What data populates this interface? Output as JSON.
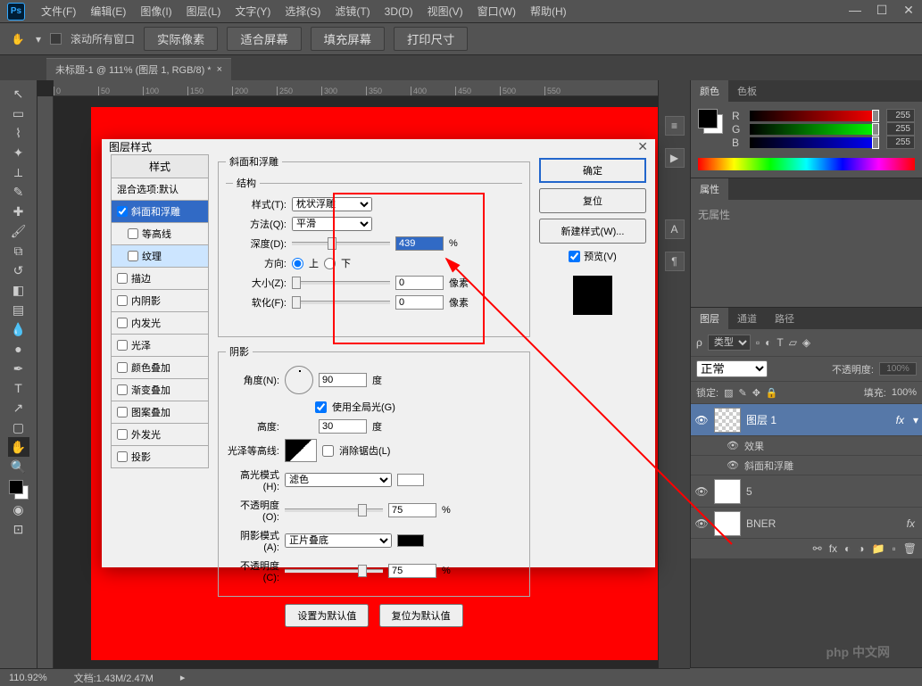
{
  "app": {
    "icon": "Ps"
  },
  "menubar": [
    "文件(F)",
    "编辑(E)",
    "图像(I)",
    "图层(L)",
    "文字(Y)",
    "选择(S)",
    "滤镜(T)",
    "3D(D)",
    "视图(V)",
    "窗口(W)",
    "帮助(H)"
  ],
  "optionsbar": {
    "scroll_all": "滚动所有窗口",
    "actual_pixels": "实际像素",
    "fit_screen": "适合屏幕",
    "fill_screen": "填充屏幕",
    "print_size": "打印尺寸"
  },
  "doctab": {
    "title": "未标题-1 @ 111% (图层 1, RGB/8) *"
  },
  "panels": {
    "color": {
      "tab1": "颜色",
      "tab2": "色板",
      "r": "R",
      "g": "G",
      "b": "B",
      "rv": "255",
      "gv": "255",
      "bv": "255"
    },
    "props": {
      "tab": "属性",
      "empty": "无属性"
    },
    "layers": {
      "tab1": "图层",
      "tab2": "通道",
      "tab3": "路径",
      "kind": "类型",
      "blend": "正常",
      "opacity_label": "不透明度:",
      "opacity": "100%",
      "lock": "锁定:",
      "fill_label": "填充:",
      "fill": "100%",
      "item1": "图层 1",
      "fx": "fx",
      "fx_label": "效果",
      "fx_bevel": "斜面和浮雕",
      "item2": "5",
      "item3": "BNER"
    }
  },
  "statusbar": {
    "zoom": "110.92%",
    "doc": "文档:1.43M/2.47M"
  },
  "dialog": {
    "title": "图层样式",
    "styles_header": "样式",
    "blend_options": "混合选项:默认",
    "items": [
      "斜面和浮雕",
      "等高线",
      "纹理",
      "描边",
      "内阴影",
      "内发光",
      "光泽",
      "颜色叠加",
      "渐变叠加",
      "图案叠加",
      "外发光",
      "投影"
    ],
    "structure": {
      "legend": "斜面和浮雕",
      "sub_legend": "结构",
      "style": "样式(T):",
      "style_val": "枕状浮雕",
      "technique": "方法(Q):",
      "technique_val": "平滑",
      "depth": "深度(D):",
      "depth_val": "439",
      "depth_unit": "%",
      "direction": "方向:",
      "up": "上",
      "down": "下",
      "size": "大小(Z):",
      "size_val": "0",
      "size_unit": "像素",
      "soften": "软化(F):",
      "soften_val": "0",
      "soften_unit": "像素"
    },
    "shading": {
      "legend": "阴影",
      "angle": "角度(N):",
      "angle_val": "90",
      "angle_unit": "度",
      "global": "使用全局光(G)",
      "altitude": "高度:",
      "altitude_val": "30",
      "altitude_unit": "度",
      "contour": "光泽等高线:",
      "antialias": "消除锯齿(L)",
      "highlight_mode": "高光模式(H):",
      "highlight_val": "滤色",
      "highlight_op": "不透明度(O):",
      "highlight_op_val": "75",
      "pct": "%",
      "shadow_mode": "阴影模式(A):",
      "shadow_val": "正片叠底",
      "shadow_op": "不透明度(C):",
      "shadow_op_val": "75"
    },
    "reset_default": "设置为默认值",
    "restore_default": "复位为默认值",
    "buttons": {
      "ok": "确定",
      "cancel": "复位",
      "new_style": "新建样式(W)...",
      "preview": "预览(V)"
    }
  },
  "watermark": "php 中文网"
}
